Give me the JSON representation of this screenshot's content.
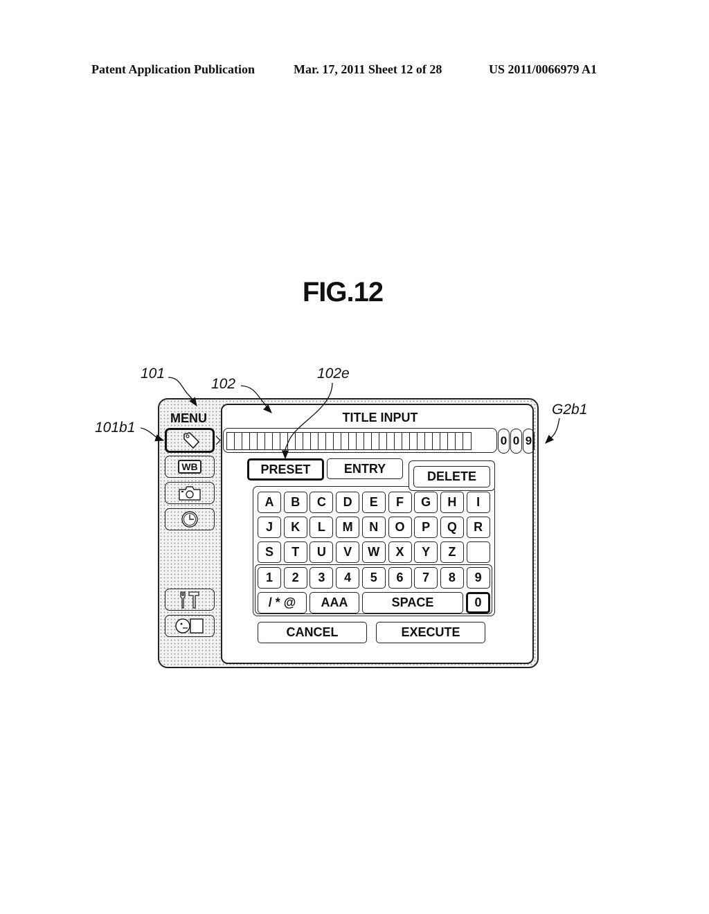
{
  "header": {
    "publication": "Patent Application Publication",
    "date_sheet": "Mar. 17, 2011  Sheet 12 of 28",
    "patent_number": "US 2011/0066979 A1"
  },
  "figure": {
    "title": "FIG.12"
  },
  "reference_labels": {
    "menu_area": "101",
    "panel": "102",
    "preset_pointer": "102e",
    "menu_button": "101b1",
    "screen": "G2b1"
  },
  "menu": {
    "label": "MENU",
    "items": [
      {
        "icon": "tag-icon",
        "selected": true
      },
      {
        "icon": "white-balance-icon",
        "text": "WB"
      },
      {
        "icon": "camera-icon"
      },
      {
        "icon": "clock-icon"
      },
      {
        "icon": "tools-icon"
      },
      {
        "icon": "face-display-icon"
      }
    ]
  },
  "panel": {
    "title": "TITLE INPUT",
    "title_field": {
      "value": "",
      "cell_count": 32
    },
    "char_counter": [
      "0",
      "0",
      "9"
    ],
    "mode_tabs": [
      {
        "label": "PRESET",
        "selected": true
      },
      {
        "label": "ENTRY",
        "selected": false
      }
    ],
    "delete_label": "DELETE",
    "keyboard": {
      "rows": [
        [
          "A",
          "B",
          "C",
          "D",
          "E",
          "F",
          "G",
          "H",
          "I"
        ],
        [
          "J",
          "K",
          "L",
          "M",
          "N",
          "O",
          "P",
          "Q",
          "R"
        ],
        [
          "S",
          "T",
          "U",
          "V",
          "W",
          "X",
          "Y",
          "Z",
          ""
        ],
        [
          "1",
          "2",
          "3",
          "4",
          "5",
          "6",
          "7",
          "8",
          "9"
        ]
      ],
      "symbols_label": "/ * @",
      "case_label": "AAA",
      "space_label": "SPACE",
      "zero_label": "0"
    },
    "cancel_label": "CANCEL",
    "execute_label": "EXECUTE"
  }
}
